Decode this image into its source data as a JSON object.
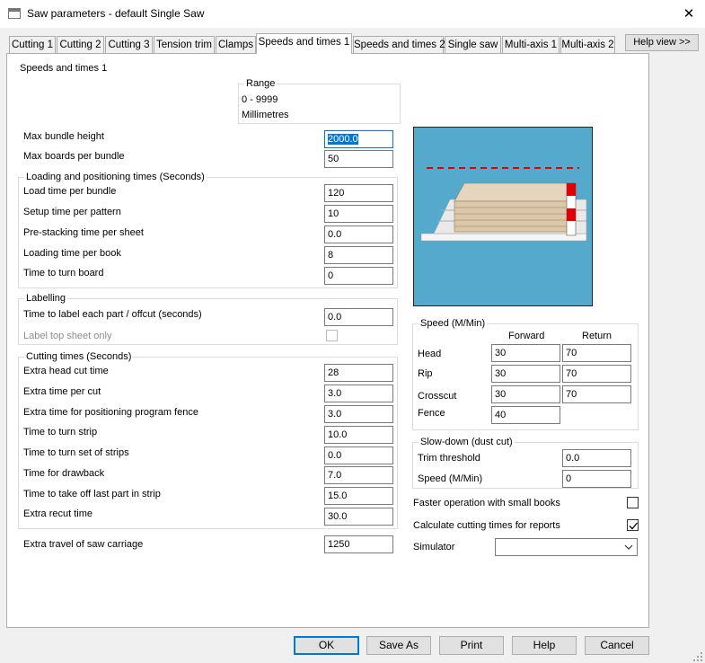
{
  "window": {
    "title": "Saw parameters - default Single Saw",
    "close_glyph": "✕"
  },
  "tabs": [
    {
      "label": "Cutting 1"
    },
    {
      "label": "Cutting 2"
    },
    {
      "label": "Cutting 3"
    },
    {
      "label": "Tension trim"
    },
    {
      "label": "Clamps"
    },
    {
      "label": "Speeds and times 1",
      "active": true
    },
    {
      "label": "Speeds and times 2"
    },
    {
      "label": "Single saw"
    },
    {
      "label": "Multi-axis 1"
    },
    {
      "label": "Multi-axis 2"
    }
  ],
  "help_view_label": "Help view >>",
  "section_title": "Speeds and times 1",
  "range": {
    "title": "Range",
    "values": "0 - 9999",
    "units": "Millimetres"
  },
  "top_fields": [
    {
      "label": "Max bundle height",
      "value": "2000.0",
      "selected": true
    },
    {
      "label": "Max boards per bundle",
      "value": "50"
    }
  ],
  "loading": {
    "title": "Loading and positioning times (Seconds)",
    "fields": [
      {
        "label": "Load time per bundle",
        "value": "120"
      },
      {
        "label": "Setup time per pattern",
        "value": "10"
      },
      {
        "label": "Pre-stacking time per sheet",
        "value": "0.0"
      },
      {
        "label": "Loading time per book",
        "value": "8"
      },
      {
        "label": "Time to turn board",
        "value": "0"
      }
    ]
  },
  "labelling": {
    "title": "Labelling",
    "field_label": "Time to label each part / offcut (seconds)",
    "field_value": "0.0",
    "top_sheet_label": "Label top sheet only",
    "top_sheet_checked": false
  },
  "cutting": {
    "title": "Cutting times (Seconds)",
    "fields": [
      {
        "label": "Extra head cut time",
        "value": "28"
      },
      {
        "label": "Extra time per cut",
        "value": "3.0"
      },
      {
        "label": "Extra time for positioning program fence",
        "value": "3.0"
      },
      {
        "label": "Time to turn strip",
        "value": "10.0"
      },
      {
        "label": "Time to turn set of strips",
        "value": "0.0"
      },
      {
        "label": "Time for drawback",
        "value": "7.0"
      },
      {
        "label": "Time to take off last part in strip",
        "value": "15.0"
      },
      {
        "label": "Extra recut time",
        "value": "30.0"
      }
    ]
  },
  "carriage": {
    "label": "Extra travel of saw carriage",
    "value": "1250"
  },
  "speed": {
    "title": "Speed (M/Min)",
    "col_forward": "Forward",
    "col_return": "Return",
    "rows": [
      {
        "label": "Head",
        "forward": "30",
        "return": "70"
      },
      {
        "label": "Rip",
        "forward": "30",
        "return": "70"
      },
      {
        "label": "Crosscut",
        "forward": "30",
        "return": "70"
      },
      {
        "label": "Fence",
        "forward": "40"
      }
    ]
  },
  "slowdown": {
    "title": "Slow-down (dust cut)",
    "fields": [
      {
        "label": "Trim threshold",
        "value": "0.0"
      },
      {
        "label": "Speed (M/Min)",
        "value": "0"
      }
    ]
  },
  "options": {
    "faster_label": "Faster operation with small books",
    "faster_checked": false,
    "calc_label": "Calculate cutting times for reports",
    "calc_checked": true,
    "simulator_label": "Simulator",
    "simulator_value": ""
  },
  "buttons": {
    "ok": "OK",
    "save_as": "Save As",
    "print": "Print",
    "help": "Help",
    "cancel": "Cancel"
  },
  "colors": {
    "accent": "#0078d7",
    "preview_bg": "#55a9cc",
    "fence_red": "#e00000"
  }
}
